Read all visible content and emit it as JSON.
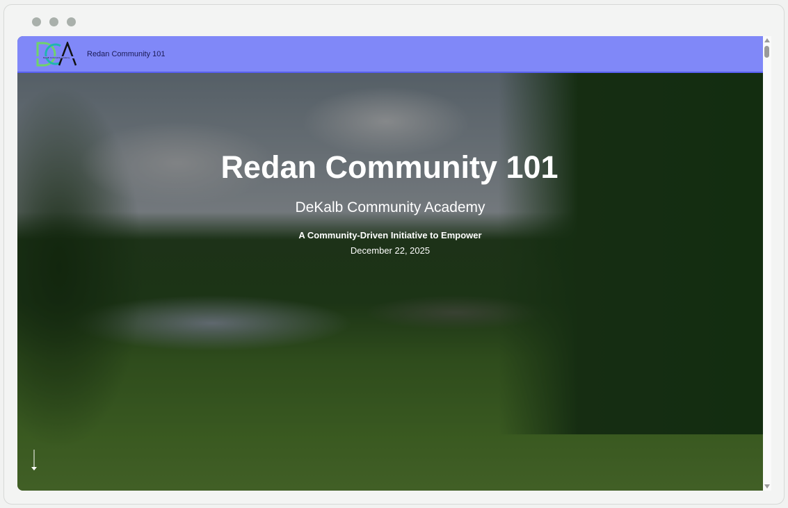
{
  "browser": {
    "controls": [
      "close",
      "minimize",
      "maximize"
    ]
  },
  "nav": {
    "logo_text": "DCA",
    "logo_subtext": "Dekalb Community Academy",
    "title": "Redan Community 101"
  },
  "hero": {
    "title": "Redan Community 101",
    "subtitle": "DeKalb Community Academy",
    "tagline": "A Community-Driven Initiative to Empower",
    "date": "December 22, 2025"
  },
  "colors": {
    "nav_bg": "#8088f8",
    "nav_border": "#5860f0"
  }
}
